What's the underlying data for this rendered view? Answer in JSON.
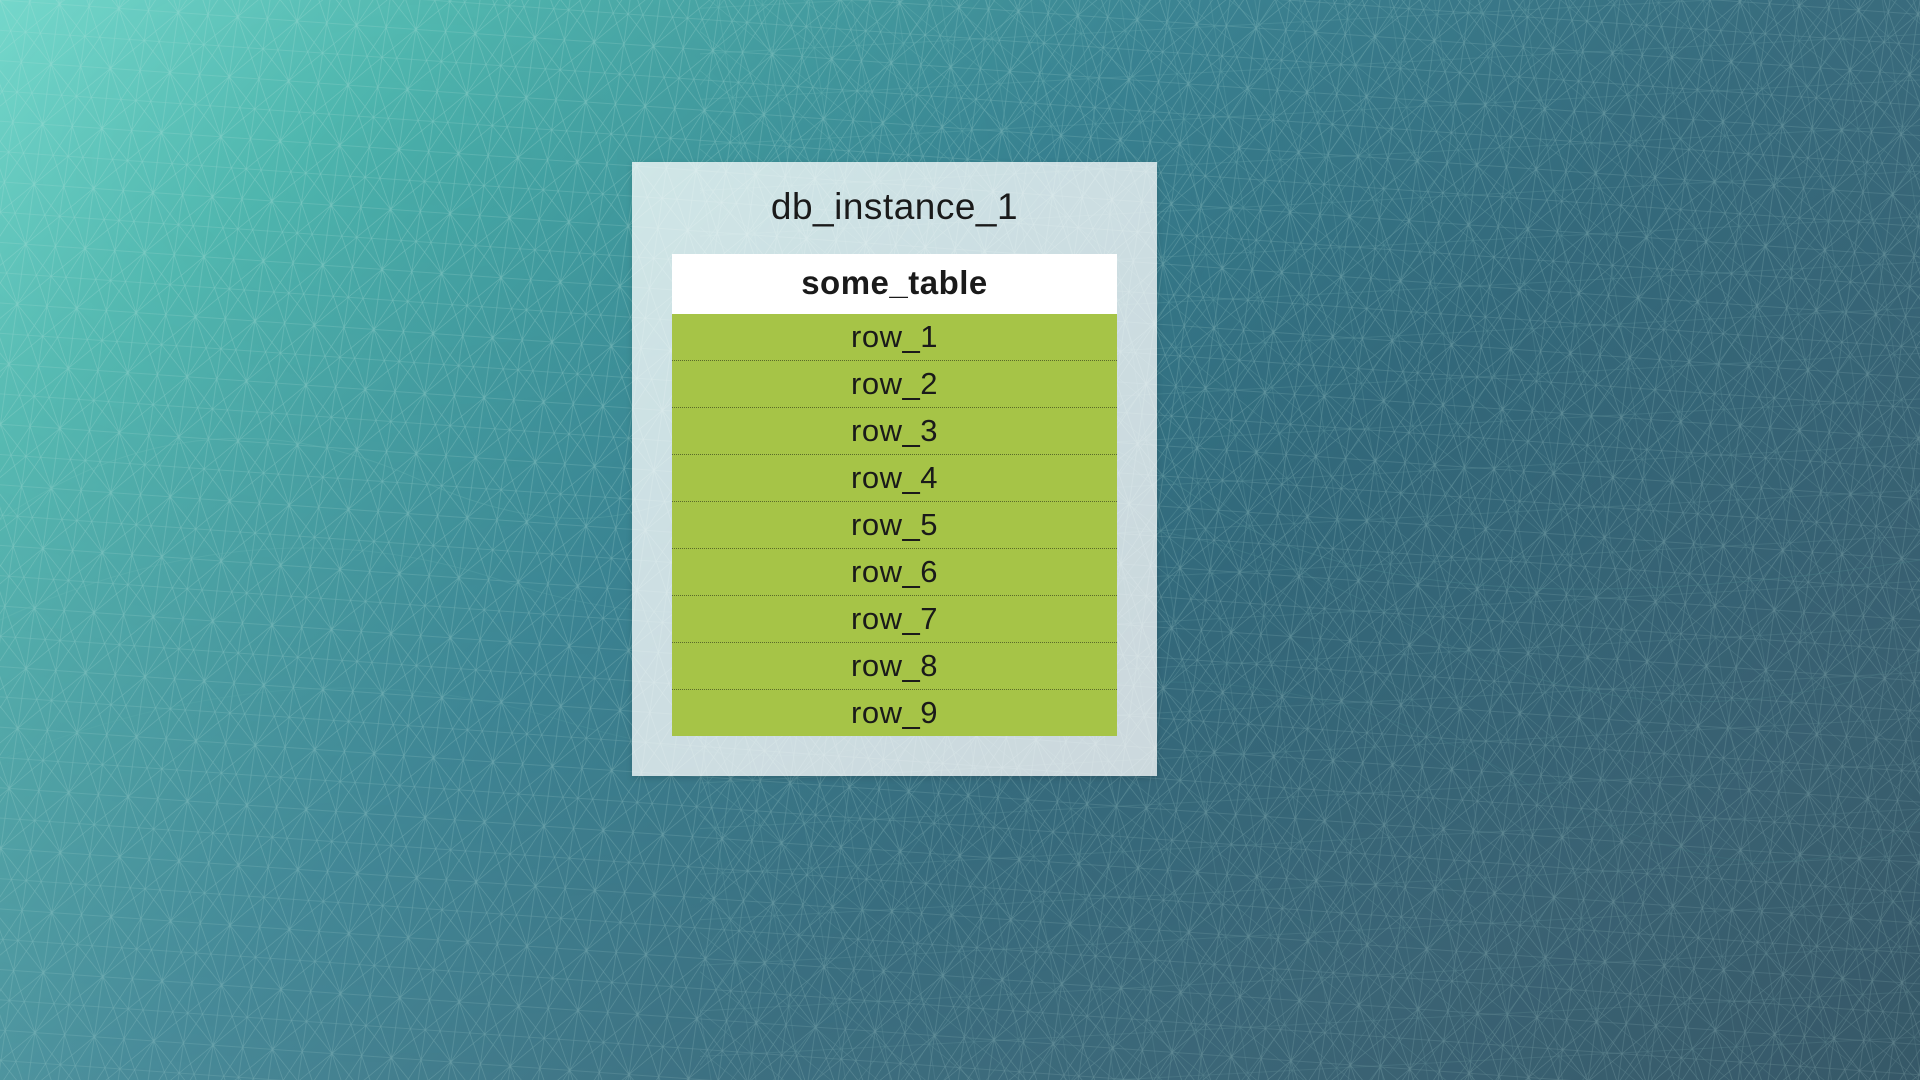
{
  "database": {
    "instance_name": "db_instance_1",
    "table": {
      "name": "some_table",
      "rows": [
        "row_1",
        "row_2",
        "row_3",
        "row_4",
        "row_5",
        "row_6",
        "row_7",
        "row_8",
        "row_9"
      ]
    }
  },
  "colors": {
    "row_bg": "#a6c447",
    "container_bg": "rgba(255,255,255,0.75)"
  }
}
